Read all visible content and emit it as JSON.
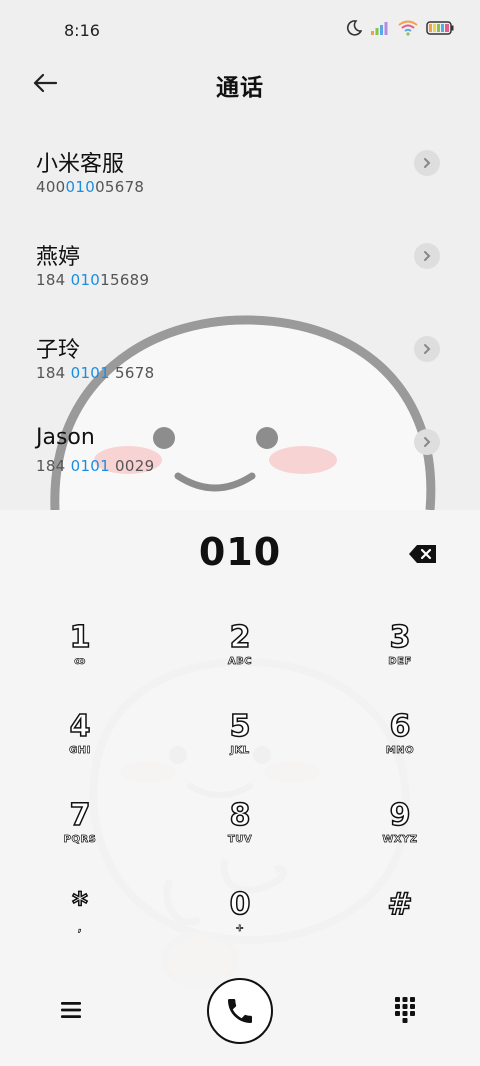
{
  "status_bar": {
    "time": "8:16",
    "icons": [
      "moon-icon",
      "signal-icon",
      "wifi-icon",
      "battery-icon"
    ]
  },
  "header": {
    "title": "通话",
    "back_icon": "arrow-left-icon"
  },
  "contacts": [
    {
      "name": "小米客服",
      "number_pre": "400",
      "number_hl": "010",
      "number_post": "05678"
    },
    {
      "name": "燕婷",
      "number_pre": "184 ",
      "number_hl": "010",
      "number_post": "15689"
    },
    {
      "name": "子玲",
      "number_pre": "184 ",
      "number_hl": "0101",
      "number_post": " 5678"
    },
    {
      "name": "Jason",
      "number_pre": "184 ",
      "number_hl": "0101",
      "number_post": " 0029"
    }
  ],
  "dialer": {
    "input": "010",
    "keys": [
      {
        "digit": "1",
        "letters": "ꝏ"
      },
      {
        "digit": "2",
        "letters": "ABC"
      },
      {
        "digit": "3",
        "letters": "DEF"
      },
      {
        "digit": "4",
        "letters": "GHI"
      },
      {
        "digit": "5",
        "letters": "JKL"
      },
      {
        "digit": "6",
        "letters": "MNO"
      },
      {
        "digit": "7",
        "letters": "PQRS"
      },
      {
        "digit": "8",
        "letters": "TUV"
      },
      {
        "digit": "9",
        "letters": "WXYZ"
      },
      {
        "digit": "*",
        "letters": ","
      },
      {
        "digit": "0",
        "letters": "+"
      },
      {
        "digit": "#",
        "letters": ""
      }
    ]
  },
  "colors": {
    "highlight": "#1a8ee0",
    "background": "#efefef",
    "panel": "#f5f5f5"
  }
}
